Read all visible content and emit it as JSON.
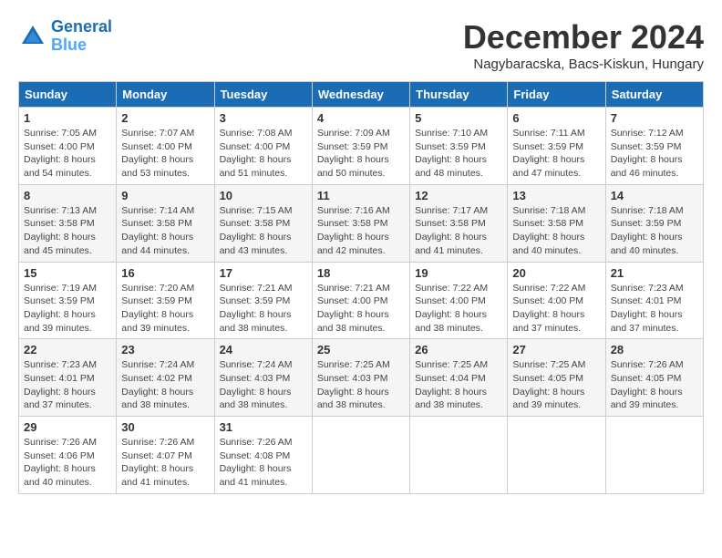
{
  "header": {
    "logo_line1": "General",
    "logo_line2": "Blue",
    "month_title": "December 2024",
    "subtitle": "Nagybaracska, Bacs-Kiskun, Hungary"
  },
  "weekdays": [
    "Sunday",
    "Monday",
    "Tuesday",
    "Wednesday",
    "Thursday",
    "Friday",
    "Saturday"
  ],
  "weeks": [
    [
      {
        "day": "1",
        "sunrise": "7:05 AM",
        "sunset": "4:00 PM",
        "daylight": "8 hours and 54 minutes."
      },
      {
        "day": "2",
        "sunrise": "7:07 AM",
        "sunset": "4:00 PM",
        "daylight": "8 hours and 53 minutes."
      },
      {
        "day": "3",
        "sunrise": "7:08 AM",
        "sunset": "4:00 PM",
        "daylight": "8 hours and 51 minutes."
      },
      {
        "day": "4",
        "sunrise": "7:09 AM",
        "sunset": "3:59 PM",
        "daylight": "8 hours and 50 minutes."
      },
      {
        "day": "5",
        "sunrise": "7:10 AM",
        "sunset": "3:59 PM",
        "daylight": "8 hours and 48 minutes."
      },
      {
        "day": "6",
        "sunrise": "7:11 AM",
        "sunset": "3:59 PM",
        "daylight": "8 hours and 47 minutes."
      },
      {
        "day": "7",
        "sunrise": "7:12 AM",
        "sunset": "3:59 PM",
        "daylight": "8 hours and 46 minutes."
      }
    ],
    [
      {
        "day": "8",
        "sunrise": "7:13 AM",
        "sunset": "3:58 PM",
        "daylight": "8 hours and 45 minutes."
      },
      {
        "day": "9",
        "sunrise": "7:14 AM",
        "sunset": "3:58 PM",
        "daylight": "8 hours and 44 minutes."
      },
      {
        "day": "10",
        "sunrise": "7:15 AM",
        "sunset": "3:58 PM",
        "daylight": "8 hours and 43 minutes."
      },
      {
        "day": "11",
        "sunrise": "7:16 AM",
        "sunset": "3:58 PM",
        "daylight": "8 hours and 42 minutes."
      },
      {
        "day": "12",
        "sunrise": "7:17 AM",
        "sunset": "3:58 PM",
        "daylight": "8 hours and 41 minutes."
      },
      {
        "day": "13",
        "sunrise": "7:18 AM",
        "sunset": "3:58 PM",
        "daylight": "8 hours and 40 minutes."
      },
      {
        "day": "14",
        "sunrise": "7:18 AM",
        "sunset": "3:59 PM",
        "daylight": "8 hours and 40 minutes."
      }
    ],
    [
      {
        "day": "15",
        "sunrise": "7:19 AM",
        "sunset": "3:59 PM",
        "daylight": "8 hours and 39 minutes."
      },
      {
        "day": "16",
        "sunrise": "7:20 AM",
        "sunset": "3:59 PM",
        "daylight": "8 hours and 39 minutes."
      },
      {
        "day": "17",
        "sunrise": "7:21 AM",
        "sunset": "3:59 PM",
        "daylight": "8 hours and 38 minutes."
      },
      {
        "day": "18",
        "sunrise": "7:21 AM",
        "sunset": "4:00 PM",
        "daylight": "8 hours and 38 minutes."
      },
      {
        "day": "19",
        "sunrise": "7:22 AM",
        "sunset": "4:00 PM",
        "daylight": "8 hours and 38 minutes."
      },
      {
        "day": "20",
        "sunrise": "7:22 AM",
        "sunset": "4:00 PM",
        "daylight": "8 hours and 37 minutes."
      },
      {
        "day": "21",
        "sunrise": "7:23 AM",
        "sunset": "4:01 PM",
        "daylight": "8 hours and 37 minutes."
      }
    ],
    [
      {
        "day": "22",
        "sunrise": "7:23 AM",
        "sunset": "4:01 PM",
        "daylight": "8 hours and 37 minutes."
      },
      {
        "day": "23",
        "sunrise": "7:24 AM",
        "sunset": "4:02 PM",
        "daylight": "8 hours and 38 minutes."
      },
      {
        "day": "24",
        "sunrise": "7:24 AM",
        "sunset": "4:03 PM",
        "daylight": "8 hours and 38 minutes."
      },
      {
        "day": "25",
        "sunrise": "7:25 AM",
        "sunset": "4:03 PM",
        "daylight": "8 hours and 38 minutes."
      },
      {
        "day": "26",
        "sunrise": "7:25 AM",
        "sunset": "4:04 PM",
        "daylight": "8 hours and 38 minutes."
      },
      {
        "day": "27",
        "sunrise": "7:25 AM",
        "sunset": "4:05 PM",
        "daylight": "8 hours and 39 minutes."
      },
      {
        "day": "28",
        "sunrise": "7:26 AM",
        "sunset": "4:05 PM",
        "daylight": "8 hours and 39 minutes."
      }
    ],
    [
      {
        "day": "29",
        "sunrise": "7:26 AM",
        "sunset": "4:06 PM",
        "daylight": "8 hours and 40 minutes."
      },
      {
        "day": "30",
        "sunrise": "7:26 AM",
        "sunset": "4:07 PM",
        "daylight": "8 hours and 41 minutes."
      },
      {
        "day": "31",
        "sunrise": "7:26 AM",
        "sunset": "4:08 PM",
        "daylight": "8 hours and 41 minutes."
      },
      null,
      null,
      null,
      null
    ]
  ],
  "labels": {
    "sunrise": "Sunrise:",
    "sunset": "Sunset:",
    "daylight": "Daylight:"
  }
}
